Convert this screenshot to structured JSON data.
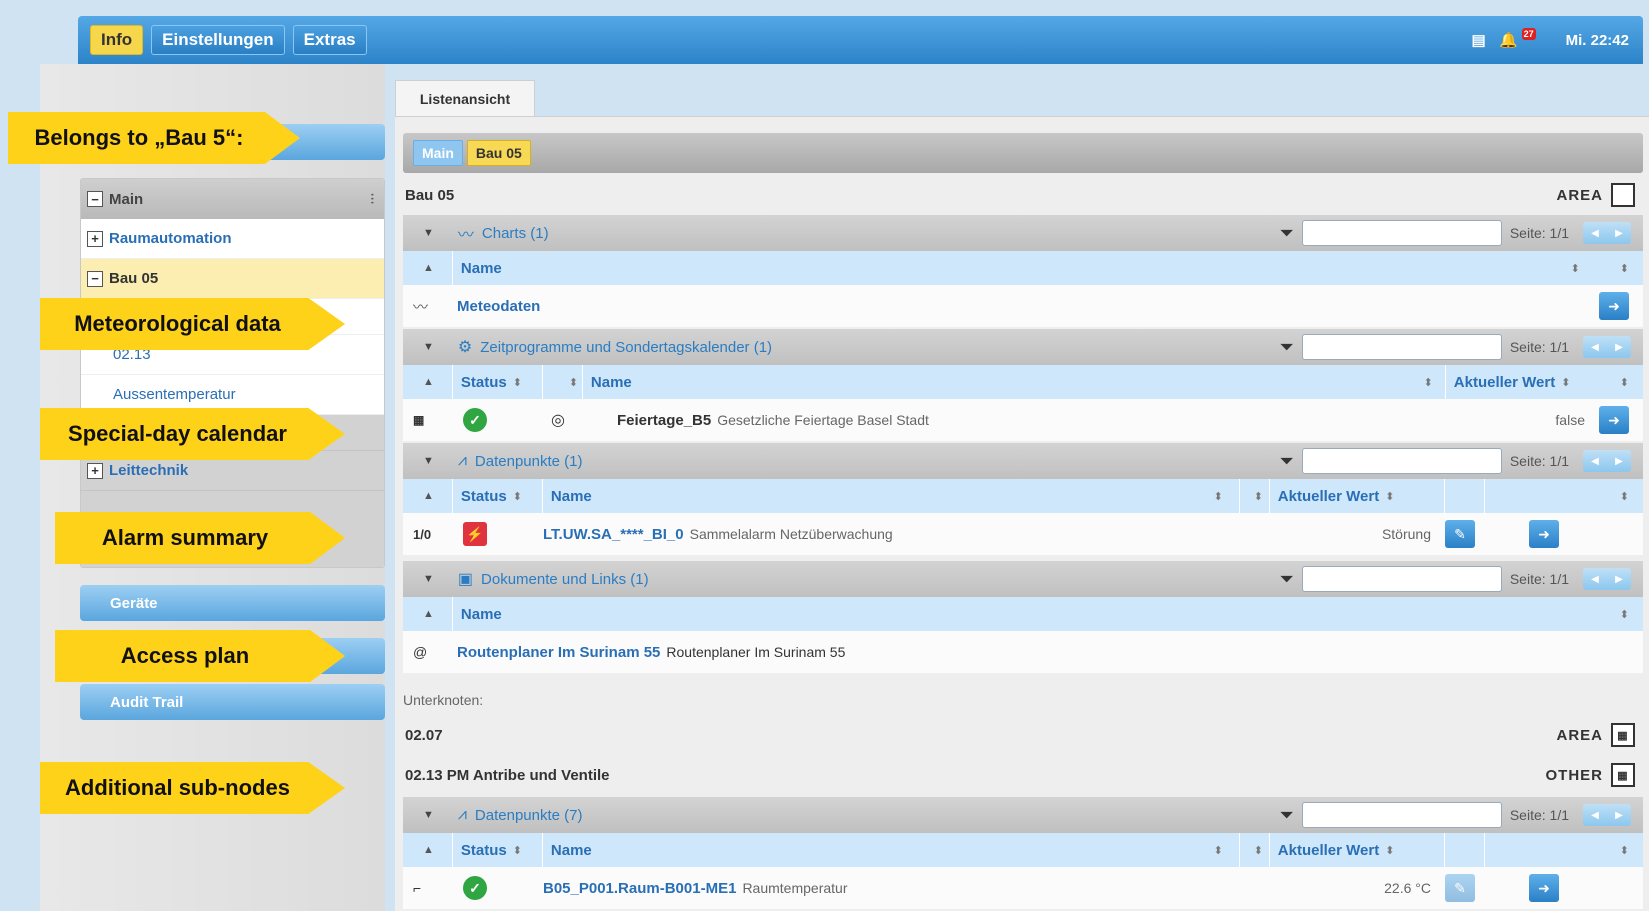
{
  "topbar": {
    "tabs": [
      "Info",
      "Einstellungen",
      "Extras"
    ],
    "notification_count": "27",
    "clock": "Mi. 22:42"
  },
  "sidebar": {
    "bars": [
      "Geräte",
      "Audit Trail"
    ],
    "tree": {
      "header": "Main",
      "items": [
        "Raumautomation",
        "Bau 05",
        "02.13",
        "Aussentemperatur",
        "Leittechnik"
      ]
    }
  },
  "callouts": [
    "Belongs to „Bau 5“:",
    "Meteorological data",
    "Special-day calendar",
    "Alarm summary",
    "Access plan",
    "Additional sub-nodes"
  ],
  "main": {
    "tab_label": "Listenansicht",
    "breadcrumb": [
      "Main",
      "Bau 05"
    ],
    "node_title": "Bau 05",
    "node_type": "AREA",
    "page_label": "Seite: 1/1",
    "sections": {
      "charts": {
        "title": "Charts (1)",
        "col_name": "Name",
        "rows": [
          {
            "name": "Meteodaten"
          }
        ]
      },
      "zeit": {
        "title": "Zeitprogramme und Sondertagskalender (1)",
        "col_status": "Status",
        "col_name": "Name",
        "col_value": "Aktueller Wert",
        "rows": [
          {
            "name": "Feiertage_B5",
            "desc": "Gesetzliche Feiertage Basel Stadt",
            "value": "false"
          }
        ]
      },
      "dp": {
        "title": "Datenpunkte (1)",
        "col_status": "Status",
        "col_name": "Name",
        "col_value": "Aktueller Wert",
        "rows": [
          {
            "type": "1/0",
            "name": "LT.UW.SA_****_BI_0",
            "desc": "Sammelalarm Netzüberwachung",
            "value": "Störung"
          }
        ]
      },
      "docs": {
        "title": "Dokumente und Links (1)",
        "col_name": "Name",
        "rows": [
          {
            "name": "Routenplaner Im Surinam 55",
            "desc": "Routenplaner Im Surinam 55"
          }
        ]
      }
    },
    "subnodes": {
      "label": "Unterknoten:",
      "items": [
        {
          "name": "02.07",
          "type": "AREA"
        },
        {
          "name": "02.13 PM Antribe und Ventile",
          "type": "OTHER"
        }
      ]
    },
    "dp2": {
      "title": "Datenpunkte (7)",
      "col_status": "Status",
      "col_name": "Name",
      "col_value": "Aktueller Wert",
      "rows": [
        {
          "name": "B05_P001.Raum-B001-ME1",
          "desc": "Raumtemperatur",
          "value": "22.6 °C"
        }
      ]
    }
  }
}
